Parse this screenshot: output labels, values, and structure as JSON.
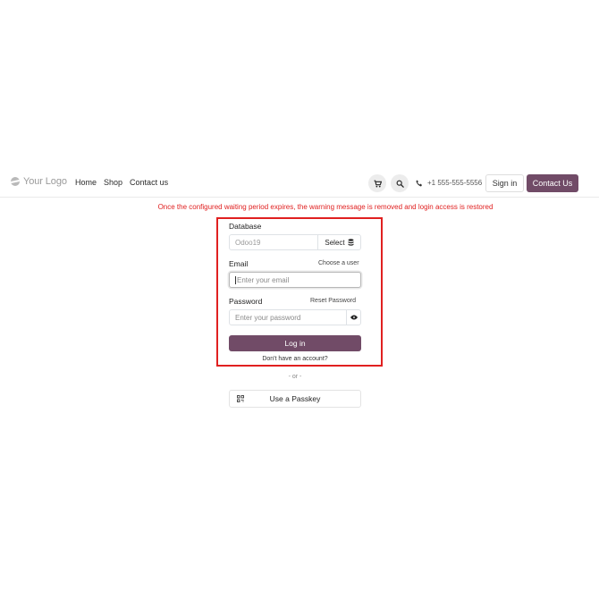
{
  "header": {
    "logo_text": "Your Logo",
    "nav": [
      {
        "label": "Home"
      },
      {
        "label": "Shop"
      },
      {
        "label": "Contact us"
      }
    ],
    "phone": "+1 555-555-5556",
    "sign_in_label": "Sign in",
    "contact_label": "Contact Us",
    "icons": {
      "cart": "cart-icon",
      "search": "search-icon",
      "phone": "phone-icon"
    }
  },
  "warning": "Once the configured waiting period expires, the warning message is removed and login access is restored",
  "form": {
    "database": {
      "label": "Database",
      "value": "Odoo19",
      "select_label": "Select"
    },
    "email": {
      "label": "Email",
      "choose_user_label": "Choose a user",
      "placeholder": "Enter your email",
      "value": ""
    },
    "password": {
      "label": "Password",
      "reset_label": "Reset Password",
      "placeholder": "Enter your password",
      "value": ""
    },
    "login_label": "Log in",
    "no_account_label": "Don't have an account?",
    "or_label": "- or -",
    "passkey_label": "Use a Passkey"
  },
  "colors": {
    "brand": "#714b67",
    "warning": "#e02020",
    "highlight_border": "#e02020"
  }
}
